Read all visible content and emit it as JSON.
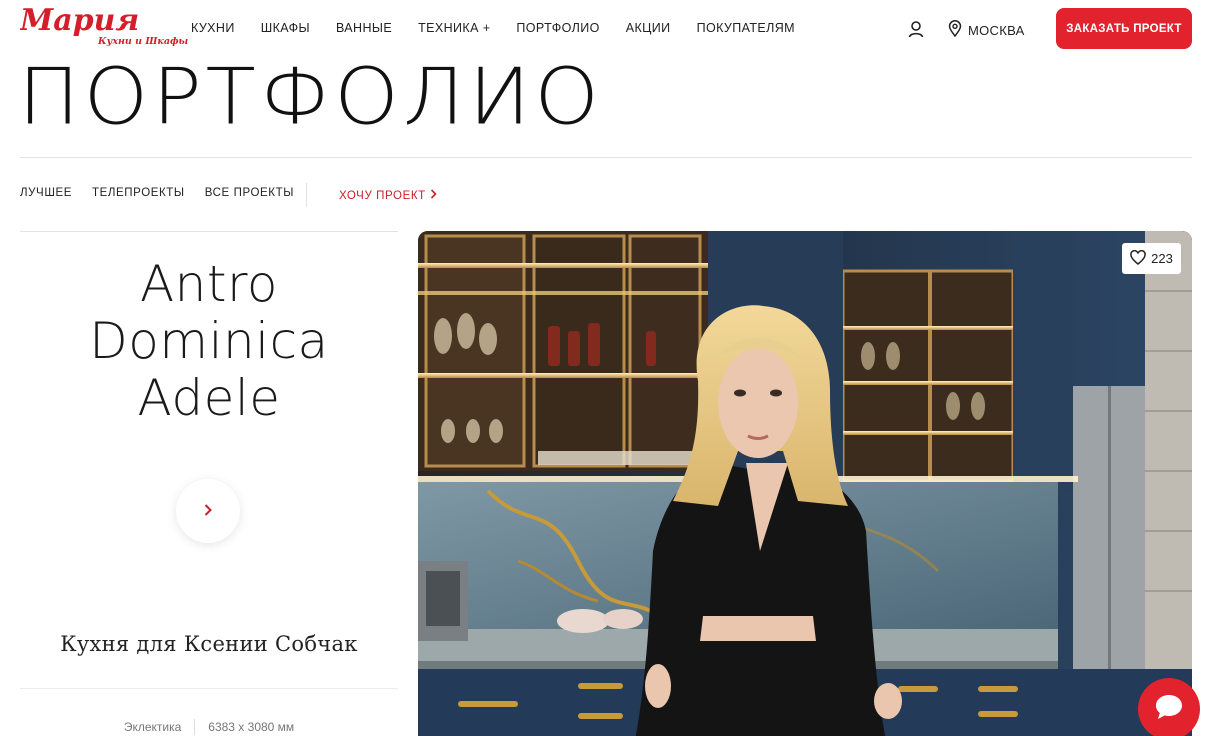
{
  "header": {
    "logo_text": "Мария",
    "logo_sub": "Кухни и Шкафы",
    "nav": [
      "КУХНИ",
      "ШКАФЫ",
      "ВАННЫЕ",
      "ТЕХНИКА +",
      "ПОРТФОЛИО",
      "АКЦИИ",
      "ПОКУПАТЕЛЯМ"
    ],
    "city": "МОСКВА",
    "order_button": "ЗАКАЗАТЬ ПРОЕКТ"
  },
  "page": {
    "title": "ПОРТФОЛИО"
  },
  "filters": {
    "tabs": [
      "ЛУЧШЕЕ",
      "ТЕЛЕПРОЕКТЫ",
      "ВСЕ ПРОЕКТЫ"
    ],
    "want_project": "ХОЧУ ПРОЕКТ"
  },
  "project": {
    "name_lines": [
      "Antro",
      "Dominica",
      "Adele"
    ],
    "subtitle": "Кухня для Ксении Собчак",
    "style": "Эклектика",
    "dimensions": "6383 х 3080 мм",
    "likes": "223"
  },
  "icons": {
    "user": "user-icon",
    "location": "location-pin-icon",
    "chevron": "chevron-right-icon",
    "heart": "heart-icon",
    "chat": "chat-icon"
  },
  "colors": {
    "accent": "#e2232e",
    "link_red": "#c92129",
    "text": "#222222",
    "divider": "#e3e3e3"
  }
}
